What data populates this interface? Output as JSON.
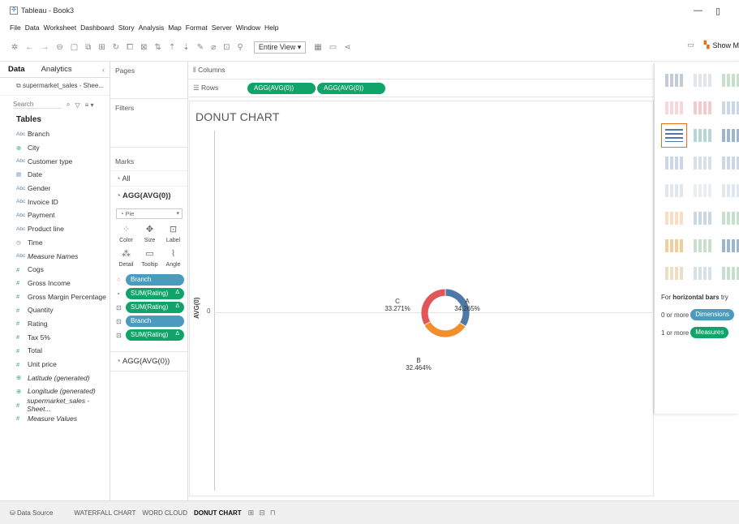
{
  "window": {
    "title": "Tableau - Book3"
  },
  "menu": [
    "File",
    "Data",
    "Worksheet",
    "Dashboard",
    "Story",
    "Analysis",
    "Map",
    "Format",
    "Server",
    "Window",
    "Help"
  ],
  "toolbar": {
    "view_select": "Entire View",
    "show_me": "Show M"
  },
  "left_pane": {
    "tab_data": "Data",
    "tab_analytics": "Analytics",
    "datasource": "supermarket_sales - Shee...",
    "search_placeholder": "Search",
    "tables_heading": "Tables",
    "fields": [
      {
        "type": "Abc",
        "name": "Branch"
      },
      {
        "type": "globe",
        "name": "City"
      },
      {
        "type": "Abc",
        "name": "Customer type"
      },
      {
        "type": "date",
        "name": "Date"
      },
      {
        "type": "Abc",
        "name": "Gender"
      },
      {
        "type": "Abc",
        "name": "Invoice ID"
      },
      {
        "type": "Abc",
        "name": "Payment"
      },
      {
        "type": "Abc",
        "name": "Product line"
      },
      {
        "type": "time",
        "name": "Time"
      },
      {
        "type": "Abc",
        "name": "Measure Names",
        "italic": true
      },
      {
        "type": "#",
        "name": "Cogs"
      },
      {
        "type": "#",
        "name": "Gross Income"
      },
      {
        "type": "#",
        "name": "Gross Margin Percentage"
      },
      {
        "type": "#",
        "name": "Quantity"
      },
      {
        "type": "#",
        "name": "Rating"
      },
      {
        "type": "#",
        "name": "Tax 5%"
      },
      {
        "type": "#",
        "name": "Total"
      },
      {
        "type": "#",
        "name": "Unit price"
      },
      {
        "type": "globe",
        "name": "Latitude (generated)",
        "italic": true
      },
      {
        "type": "globe",
        "name": "Longitude (generated)",
        "italic": true
      },
      {
        "type": "#",
        "name": "supermarket_sales - Sheet...",
        "italic": true
      },
      {
        "type": "#",
        "name": "Measure Values",
        "italic": true
      }
    ]
  },
  "cards": {
    "pages": "Pages",
    "filters": "Filters",
    "marks": "Marks",
    "all": "All",
    "agg1": "AGG(AVG(0))",
    "agg2": "AGG(AVG(0))",
    "mark_type": "Pie",
    "buttons": [
      "Color",
      "Size",
      "Label",
      "Detail",
      "Tooltip",
      "Angle"
    ],
    "pills": [
      {
        "kind": "dim",
        "icon": "color",
        "text": "Branch"
      },
      {
        "kind": "mea",
        "icon": "angle",
        "text": "SUM(Rating)",
        "delta": true
      },
      {
        "kind": "mea",
        "icon": "label",
        "text": "SUM(Rating)",
        "delta": true
      },
      {
        "kind": "dim",
        "icon": "label",
        "text": "Branch"
      },
      {
        "kind": "mea",
        "icon": "label",
        "text": "SUM(Rating)",
        "delta": true
      }
    ]
  },
  "shelves": {
    "columns": "Columns",
    "rows": "Rows",
    "row_pills": [
      "AGG(AVG(0))",
      "AGG(AVG(0))"
    ]
  },
  "sheet": {
    "title": "DONUT CHART",
    "yaxis_label": "AVG(0)",
    "ytick": "0"
  },
  "chart_data": {
    "type": "pie",
    "donut": true,
    "categories": [
      "A",
      "B",
      "C"
    ],
    "values": [
      34.265,
      32.464,
      33.271
    ],
    "labels": [
      "34.265%",
      "32.464%",
      "33.271%"
    ],
    "colors": [
      "#4e79a7",
      "#f28e2b",
      "#e15759"
    ]
  },
  "show_me": {
    "hint_prefix": "For",
    "hint_bold": "horizontal bars",
    "hint_suffix": "try",
    "dim_prefix": "0 or more",
    "dim_pill": "Dimensions",
    "mea_prefix": "1 or more",
    "mea_pill": "Measures"
  },
  "statusbar": {
    "datasource": "Data Source",
    "tabs": [
      "WATERFALL CHART",
      "WORD CLOUD",
      "DONUT CHART"
    ],
    "active": "DONUT CHART"
  }
}
